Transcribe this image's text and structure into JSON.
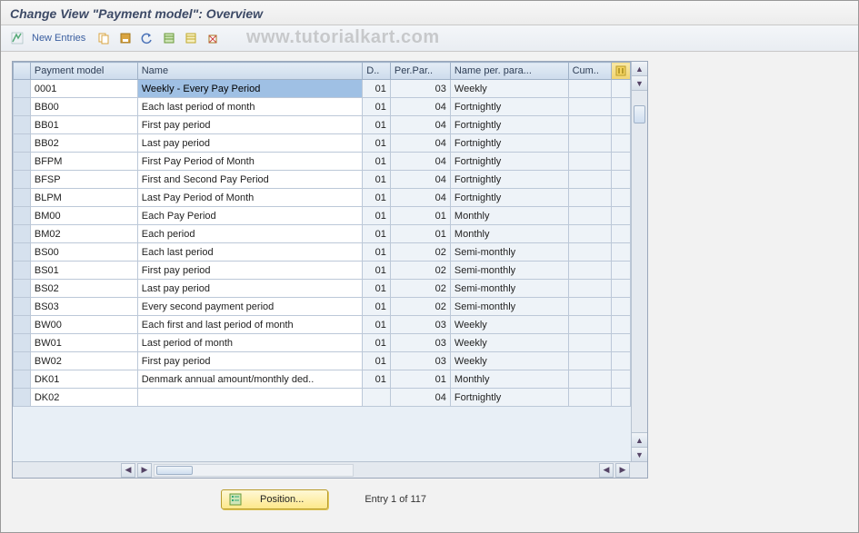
{
  "title": "Change View \"Payment model\": Overview",
  "toolbar": {
    "new_entries": "New Entries"
  },
  "watermark": "www.tutorialkart.com",
  "columns": {
    "c0": "",
    "c1": "Payment model",
    "c2": "Name",
    "c3": "D..",
    "c4": "Per.Par..",
    "c5": "Name per. para...",
    "c6": "Cum.."
  },
  "rows": [
    {
      "pm": "0001",
      "name": "Weekly - Every Pay Period",
      "d": "01",
      "pp": "03",
      "np": "Weekly",
      "cu": ""
    },
    {
      "pm": "BB00",
      "name": "Each last period of month",
      "d": "01",
      "pp": "04",
      "np": "Fortnightly",
      "cu": ""
    },
    {
      "pm": "BB01",
      "name": "First pay period",
      "d": "01",
      "pp": "04",
      "np": "Fortnightly",
      "cu": ""
    },
    {
      "pm": "BB02",
      "name": "Last pay period",
      "d": "01",
      "pp": "04",
      "np": "Fortnightly",
      "cu": ""
    },
    {
      "pm": "BFPM",
      "name": "First Pay Period of Month",
      "d": "01",
      "pp": "04",
      "np": "Fortnightly",
      "cu": ""
    },
    {
      "pm": "BFSP",
      "name": "First and Second Pay Period",
      "d": "01",
      "pp": "04",
      "np": "Fortnightly",
      "cu": ""
    },
    {
      "pm": "BLPM",
      "name": "Last Pay Period of Month",
      "d": "01",
      "pp": "04",
      "np": "Fortnightly",
      "cu": ""
    },
    {
      "pm": "BM00",
      "name": "Each Pay Period",
      "d": "01",
      "pp": "01",
      "np": "Monthly",
      "cu": ""
    },
    {
      "pm": "BM02",
      "name": "Each period",
      "d": "01",
      "pp": "01",
      "np": "Monthly",
      "cu": ""
    },
    {
      "pm": "BS00",
      "name": "Each last period",
      "d": "01",
      "pp": "02",
      "np": "Semi-monthly",
      "cu": ""
    },
    {
      "pm": "BS01",
      "name": "First pay period",
      "d": "01",
      "pp": "02",
      "np": "Semi-monthly",
      "cu": ""
    },
    {
      "pm": "BS02",
      "name": "Last pay period",
      "d": "01",
      "pp": "02",
      "np": "Semi-monthly",
      "cu": ""
    },
    {
      "pm": "BS03",
      "name": "Every second payment period",
      "d": "01",
      "pp": "02",
      "np": "Semi-monthly",
      "cu": ""
    },
    {
      "pm": "BW00",
      "name": "Each first and last period of month",
      "d": "01",
      "pp": "03",
      "np": "Weekly",
      "cu": ""
    },
    {
      "pm": "BW01",
      "name": "Last period of month",
      "d": "01",
      "pp": "03",
      "np": "Weekly",
      "cu": ""
    },
    {
      "pm": "BW02",
      "name": "First pay period",
      "d": "01",
      "pp": "03",
      "np": "Weekly",
      "cu": ""
    },
    {
      "pm": "DK01",
      "name": "Denmark annual amount/monthly ded..",
      "d": "01",
      "pp": "01",
      "np": "Monthly",
      "cu": ""
    },
    {
      "pm": "DK02",
      "name": "",
      "d": "",
      "pp": "04",
      "np": "Fortnightly",
      "cu": ""
    }
  ],
  "footer": {
    "position_label": "Position...",
    "entry_status": "Entry 1 of 117"
  }
}
